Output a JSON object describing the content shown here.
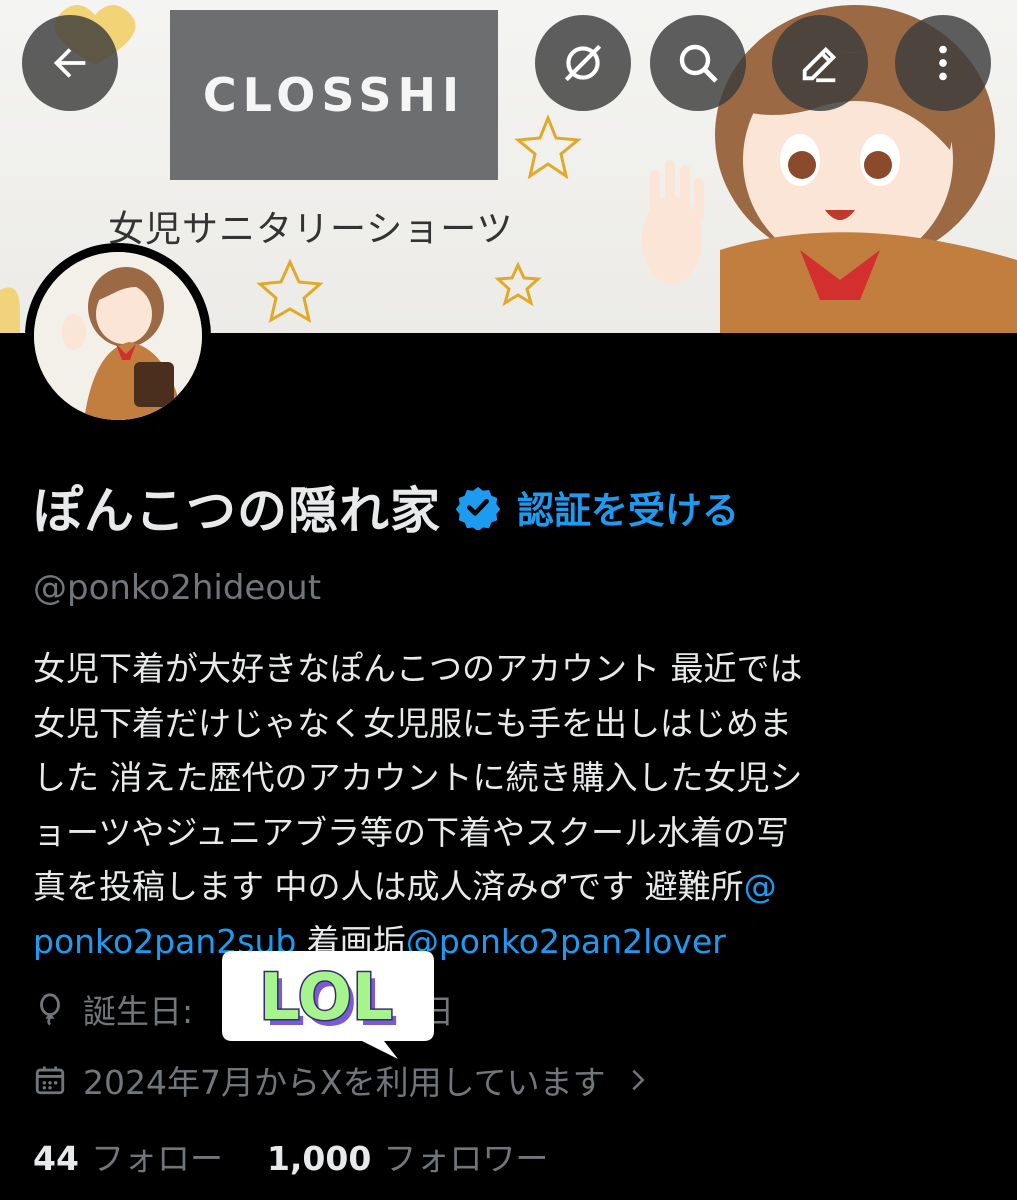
{
  "banner": {
    "logo_text": "CLOSSHI",
    "subtitle": "女児サニタリーショーツ"
  },
  "toolbar": {
    "back_icon": "arrow-left-icon",
    "grok_icon": "grok-icon",
    "search_icon": "search-icon",
    "edit_icon": "edit-icon",
    "more_icon": "more-vertical-icon"
  },
  "profile": {
    "display_name": "ぽんこつの隠れ家",
    "verify_label": "認証を受ける",
    "handle": "@ponko2hideout",
    "bio": {
      "text1": "女児下着が大好きなぽんこつのアカウント 最近では\n女児下着だけじゃなく女児服にも手を出しはじめま\nした 消えた歴代のアカウントに続き購入した女児シ\nョーツやジュニアブラ等の下着やスクール水着の写\n真を投稿します 中の人は成人済み♂です 避難所",
      "link1_part1": "@",
      "link1_part2": "ponko2pan2sub",
      "text2": " 着画垢",
      "link2": "@ponko2pan2lover"
    },
    "birthday_prefix": "誕生日:",
    "birthday_suffix": "日",
    "joined": "2024年7月からXを利用しています",
    "following_count": "44",
    "following_label": "フォロー",
    "followers_count": "1,000",
    "followers_label": "フォロワー"
  },
  "sticker": {
    "text": "LOL"
  },
  "colors": {
    "accent": "#1d9bf0",
    "background": "#000000",
    "secondary_text": "#71767b",
    "sticker_fill": "#a6f58c",
    "sticker_shadow": "#7a5bd6"
  }
}
